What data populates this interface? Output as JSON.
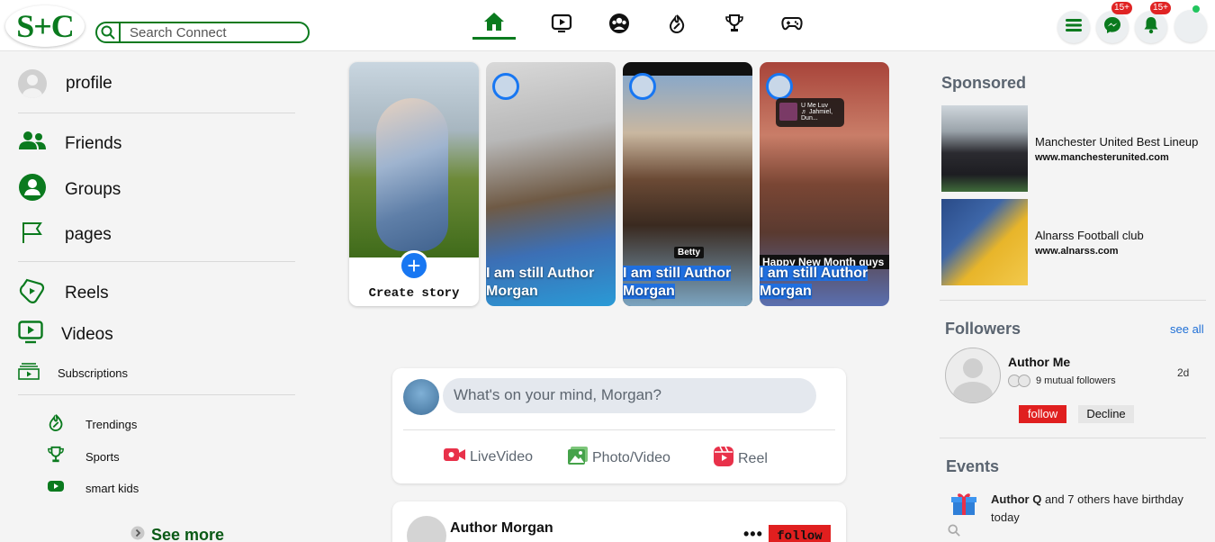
{
  "app": {
    "logo_text": "S+C",
    "brand_color": "#0a7a1e"
  },
  "search": {
    "placeholder": "Search Connect"
  },
  "nav": {
    "icons": [
      "home-icon",
      "video-icon",
      "groups-icon",
      "trending-icon",
      "trophy-icon",
      "gamepad-icon"
    ]
  },
  "topright": {
    "menu_icon": "menu-icon",
    "messenger_badge": "15+",
    "notifications_badge": "15+"
  },
  "sidebar": {
    "profile": "profile",
    "friends": "Friends",
    "groups": "Groups",
    "pages": "pages",
    "reels": "Reels",
    "videos": "Videos",
    "subscriptions": "Subscriptions",
    "trendings": "Trendings",
    "sports": "Sports",
    "smart_kids": "smart kids",
    "see_more": "See more"
  },
  "stories": {
    "create_label": "Create story",
    "items": [
      {
        "line1": "I am still Author",
        "line2": "Morgan",
        "highlighted": false
      },
      {
        "line1": "I am still Author",
        "line2": "Morgan",
        "highlighted": true,
        "tag": "Betty"
      },
      {
        "line1": "I am still Author",
        "line2": "Morgan",
        "highlighted": true,
        "music_title": "U Me Luv",
        "music_artist": "♬ Jahmiel, Dun...",
        "banner": "Happy New Month guys"
      }
    ]
  },
  "composer": {
    "prompt": "What's on your mind, Morgan?",
    "live": "LiveVideo",
    "photo": "Photo/Video",
    "reel": "Reel"
  },
  "post": {
    "author": "Author Morgan",
    "follow": "follow"
  },
  "right": {
    "sponsored_title": "Sponsored",
    "ads": [
      {
        "title": "Manchester United Best Lineup",
        "url": "www.manchesterunited.com"
      },
      {
        "title": "Alnarss Football club",
        "url": "www.alnarss.com"
      }
    ],
    "followers_title": "Followers",
    "see_all": "see all",
    "follower": {
      "name": "Author Me",
      "mutual": "9 mutual followers",
      "time": "2d",
      "follow": "follow",
      "decline": "Decline"
    },
    "events_title": "Events",
    "event": {
      "name": "Author Q",
      "rest": " and 7 others have birthday",
      "line2": "today"
    }
  }
}
